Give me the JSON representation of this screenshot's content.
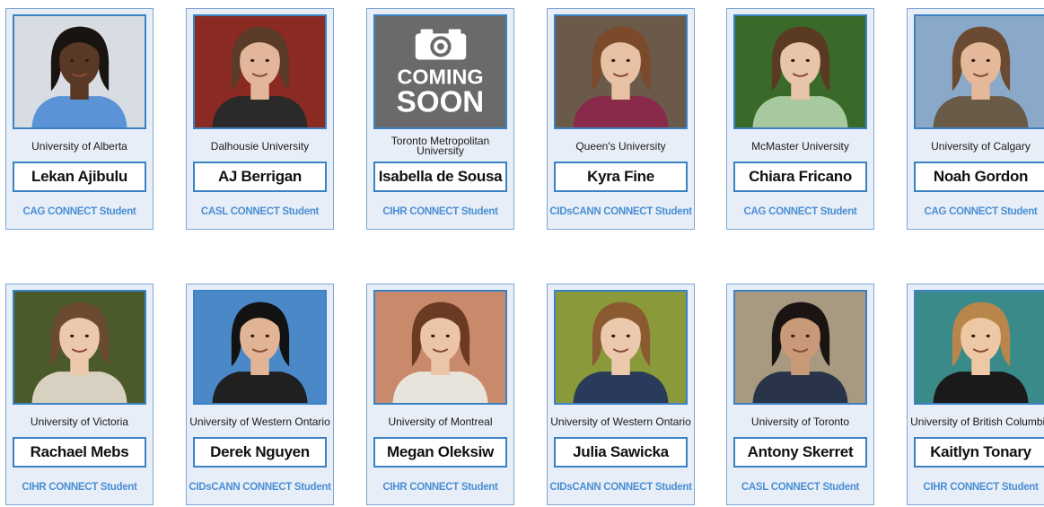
{
  "students": [
    {
      "name": "Lekan Ajibulu",
      "university": "University of Alberta",
      "program": "CAG CONNECT Student",
      "photo": "portrait",
      "bg": "#d8dde3",
      "skin": "#5a3826",
      "hair": "#1a1410",
      "shirt": "#5b93d6"
    },
    {
      "name": "AJ Berrigan",
      "university": "Dalhousie University",
      "program": "CASL CONNECT Student",
      "photo": "portrait",
      "bg": "#8b2a22",
      "skin": "#e3b59a",
      "hair": "#5a3a28",
      "shirt": "#2a2a2a"
    },
    {
      "name": "Isabella de Sousa",
      "university": "Toronto Metropolitan University",
      "program": "CIHR CONNECT Student",
      "photo": "coming-soon",
      "soon_line1": "COMING",
      "soon_line2": "SOON"
    },
    {
      "name": "Kyra Fine",
      "university": "Queen's University",
      "program": "CIDsCANN CONNECT Student",
      "photo": "portrait",
      "bg": "#6b5a4a",
      "skin": "#e8c0a4",
      "hair": "#7a4a2a",
      "shirt": "#8a2a4a"
    },
    {
      "name": "Chiara Fricano",
      "university": "McMaster University",
      "program": "CAG CONNECT Student",
      "photo": "portrait",
      "bg": "#3a6a2a",
      "skin": "#e8c4a8",
      "hair": "#5a3a22",
      "shirt": "#a8c8a0"
    },
    {
      "name": "Noah Gordon",
      "university": "University of Calgary",
      "program": "CAG CONNECT Student",
      "photo": "portrait",
      "bg": "#8aa8c8",
      "skin": "#e4b898",
      "hair": "#6a4a30",
      "shirt": "#6a5a48"
    },
    {
      "name": "Rachael Mebs",
      "university": "University of Victoria",
      "program": "CIHR CONNECT Student",
      "photo": "portrait",
      "bg": "#4a5a2a",
      "skin": "#ecc8ac",
      "hair": "#6a4a30",
      "shirt": "#d8d0c0"
    },
    {
      "name": "Derek Nguyen",
      "university": "University of Western Ontario",
      "program": "CIDsCANN CONNECT Student",
      "photo": "portrait",
      "bg": "#4a88c8",
      "skin": "#e0b494",
      "hair": "#121212",
      "shirt": "#202020"
    },
    {
      "name": "Megan Oleksiw",
      "university": "University of Montreal",
      "program": "CIHR CONNECT Student",
      "photo": "portrait",
      "bg": "#c88a6a",
      "skin": "#ecc4a8",
      "hair": "#6a3a22",
      "shirt": "#e8e4dc"
    },
    {
      "name": "Julia Sawicka",
      "university": "University of Western Ontario",
      "program": "CIDsCANN CONNECT Student",
      "photo": "portrait",
      "bg": "#8a9a3a",
      "skin": "#ecc8ac",
      "hair": "#8a5a30",
      "shirt": "#2a3a5a"
    },
    {
      "name": "Antony Skerret",
      "university": "University of Toronto",
      "program": "CASL CONNECT Student",
      "photo": "portrait",
      "bg": "#a89a80",
      "skin": "#c89a78",
      "hair": "#1a1412",
      "shirt": "#2a3448"
    },
    {
      "name": "Kaitlyn Tonary",
      "university": "University of British Columbia",
      "program": "CIHR CONNECT Student",
      "photo": "portrait",
      "bg": "#3a8a8a",
      "skin": "#eec8a4",
      "hair": "#b8864a",
      "shirt": "#1a1a1a"
    }
  ],
  "colors": {
    "card_bg": "#e8eef7",
    "border": "#3b82c4",
    "program_text": "#4a8fd4"
  }
}
